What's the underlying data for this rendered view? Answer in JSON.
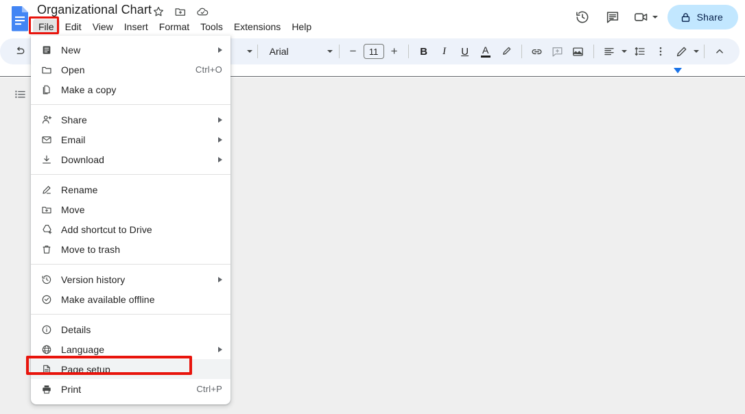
{
  "app": {
    "logo_icon": "google-docs-logo",
    "doc_title": "Organizational Chart",
    "title_icons": [
      {
        "name": "star-icon",
        "label": "Star"
      },
      {
        "name": "move-to-folder-icon",
        "label": "Move"
      },
      {
        "name": "cloud-saved-icon",
        "label": "Saved to Drive"
      }
    ]
  },
  "menubar": {
    "items": [
      {
        "label": "File",
        "name": "menu-file",
        "active": true
      },
      {
        "label": "Edit",
        "name": "menu-edit",
        "active": false
      },
      {
        "label": "View",
        "name": "menu-view",
        "active": false
      },
      {
        "label": "Insert",
        "name": "menu-insert",
        "active": false
      },
      {
        "label": "Format",
        "name": "menu-format",
        "active": false
      },
      {
        "label": "Tools",
        "name": "menu-tools",
        "active": false
      },
      {
        "label": "Extensions",
        "name": "menu-extensions",
        "active": false
      },
      {
        "label": "Help",
        "name": "menu-help",
        "active": false
      }
    ]
  },
  "header_right": {
    "version_history_icon": "history-icon",
    "comments_icon": "comment-icon",
    "meet_icon": "video-camera-icon",
    "share_label": "Share",
    "share_lock_icon": "lock-icon",
    "share_bg_color": "#c2e7ff",
    "share_text_color": "#041e49"
  },
  "toolbar": {
    "undo_icon": "undo-icon",
    "font_name": "Arial",
    "font_size": "11",
    "decrease_font_label": "−",
    "increase_font_label": "+",
    "bold_label": "B",
    "italic_label": "I",
    "underline_label": "U",
    "text_color_label": "A",
    "highlight_icon": "highlighter-icon",
    "link_icon": "link-icon",
    "comment_add_icon": "add-comment-icon",
    "image_icon": "insert-image-icon",
    "align_icon": "align-left-icon",
    "line_spacing_icon": "line-spacing-icon",
    "more_icon": "more-vertical-icon",
    "editing_mode_icon": "pencil-icon",
    "collapse_icon": "chevron-up-icon",
    "bg_color": "#edf2fa"
  },
  "ruler": {
    "margin_marker_icon": "margin-marker-icon",
    "marker_color": "#1a73e8"
  },
  "left_rail": {
    "outline_icon": "document-outline-icon"
  },
  "file_menu": {
    "groups": [
      {
        "items": [
          {
            "label": "New",
            "icon": "new-document-icon",
            "arrow": true,
            "accel": ""
          },
          {
            "label": "Open",
            "icon": "folder-open-icon",
            "arrow": false,
            "accel": "Ctrl+O"
          },
          {
            "label": "Make a copy",
            "icon": "copy-icon",
            "arrow": false,
            "accel": ""
          }
        ]
      },
      {
        "items": [
          {
            "label": "Share",
            "icon": "person-add-icon",
            "arrow": true,
            "accel": ""
          },
          {
            "label": "Email",
            "icon": "email-icon",
            "arrow": true,
            "accel": ""
          },
          {
            "label": "Download",
            "icon": "download-icon",
            "arrow": true,
            "accel": ""
          }
        ]
      },
      {
        "items": [
          {
            "label": "Rename",
            "icon": "rename-pencil-icon",
            "arrow": false,
            "accel": ""
          },
          {
            "label": "Move",
            "icon": "move-folder-icon",
            "arrow": false,
            "accel": ""
          },
          {
            "label": "Add shortcut to Drive",
            "icon": "drive-shortcut-icon",
            "arrow": false,
            "accel": ""
          },
          {
            "label": "Move to trash",
            "icon": "trash-icon",
            "arrow": false,
            "accel": ""
          }
        ]
      },
      {
        "items": [
          {
            "label": "Version history",
            "icon": "history-icon",
            "arrow": true,
            "accel": ""
          },
          {
            "label": "Make available offline",
            "icon": "offline-check-icon",
            "arrow": false,
            "accel": ""
          }
        ]
      },
      {
        "items": [
          {
            "label": "Details",
            "icon": "info-icon",
            "arrow": false,
            "accel": ""
          },
          {
            "label": "Language",
            "icon": "globe-icon",
            "arrow": true,
            "accel": ""
          },
          {
            "label": "Page setup",
            "icon": "page-setup-icon",
            "arrow": false,
            "accel": "",
            "hovered": true
          },
          {
            "label": "Print",
            "icon": "printer-icon",
            "arrow": false,
            "accel": "Ctrl+P"
          }
        ]
      }
    ]
  },
  "annotations": {
    "highlight_color": "#e8140c",
    "file_button_box": "File",
    "page_setup_box": "Page setup"
  }
}
